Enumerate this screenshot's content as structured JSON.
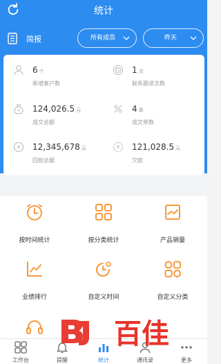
{
  "header": {
    "title": "统计",
    "refresh_icon": "refresh-icon",
    "background": "#2d8cf0"
  },
  "brief": {
    "label": "简报",
    "icon": "document-icon",
    "members_filter": "所有成员",
    "period_filter": "昨天"
  },
  "stats": [
    {
      "value": "6",
      "unit": "个",
      "label": "新增客户数",
      "icon": "user-icon"
    },
    {
      "value": "1",
      "unit": "次",
      "label": "联系跟进次数",
      "icon": "target-icon"
    },
    {
      "value": "124,026.5",
      "unit": "元",
      "label": "成交总额",
      "icon": "money-bag-icon"
    },
    {
      "value": "4",
      "unit": "单",
      "label": "成交单数",
      "icon": "order-icon"
    },
    {
      "value": "12,345,678",
      "unit": "元",
      "label": "回款总额",
      "icon": "yen-coin-icon"
    },
    {
      "value": "121,028.5",
      "unit": "元",
      "label": "欠款",
      "icon": "debt-icon"
    }
  ],
  "menu": [
    {
      "label": "按时间统计",
      "icon": "clock-icon",
      "color": "#f59a3c"
    },
    {
      "label": "按分类统计",
      "icon": "category-grid-icon",
      "color": "#f59a3c"
    },
    {
      "label": "产品销量",
      "icon": "product-chart-icon",
      "color": "#f59a3c"
    },
    {
      "label": "业绩排行",
      "icon": "trend-line-icon",
      "color": "#f59a3c"
    },
    {
      "label": "自定义时间",
      "icon": "custom-time-icon",
      "color": "#f59a3c"
    },
    {
      "label": "自定义分类",
      "icon": "custom-category-icon",
      "color": "#f59a3c"
    },
    {
      "label": "",
      "icon": "headset-icon",
      "color": "#f59a3c"
    }
  ],
  "tabs": [
    {
      "label": "工作台",
      "icon": "workbench-icon",
      "active": false
    },
    {
      "label": "提醒",
      "icon": "bell-icon",
      "active": false
    },
    {
      "label": "统计",
      "icon": "stats-icon",
      "active": true
    },
    {
      "label": "通讯录",
      "icon": "contacts-icon",
      "active": false
    },
    {
      "label": "更多",
      "icon": "more-icon",
      "active": false
    }
  ],
  "watermark": {
    "text": "百佳",
    "color": "#e8332a"
  }
}
